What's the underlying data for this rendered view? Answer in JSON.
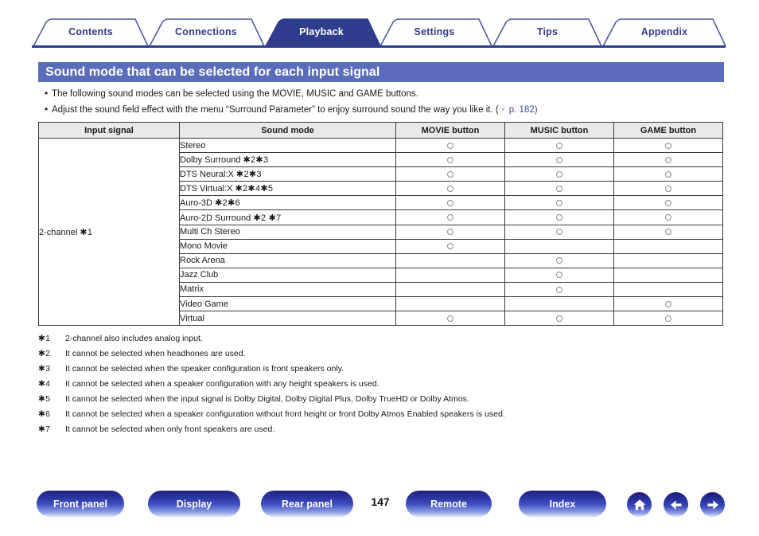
{
  "tabs": [
    {
      "label": "Contents",
      "active": false
    },
    {
      "label": "Connections",
      "active": false
    },
    {
      "label": "Playback",
      "active": true
    },
    {
      "label": "Settings",
      "active": false
    },
    {
      "label": "Tips",
      "active": false
    },
    {
      "label": "Appendix",
      "active": false
    }
  ],
  "section": {
    "title": "Sound mode that can be selected for each input signal"
  },
  "intro": [
    "The following sound modes can be selected using the MOVIE, MUSIC and GAME buttons.",
    "Adjust the sound field effect with the menu “Surround Parameter” to enjoy surround sound the way you like it.  (☞ p. 182)"
  ],
  "intro_parts": [
    {
      "text": "The following sound modes can be selected using the MOVIE, MUSIC and GAME buttons.",
      "ref": ""
    },
    {
      "text": "Adjust the sound field effect with the menu “Surround Parameter” to enjoy surround sound the way you like it.  (",
      "ref_icon": "☞",
      "ref": " p. 182)"
    }
  ],
  "table": {
    "headers": [
      "Input signal",
      "Sound mode",
      "MOVIE button",
      "MUSIC button",
      "GAME button"
    ],
    "input_signal": "2-channel ✱1",
    "input_signal_label": "2-channel",
    "input_signal_note": "✱1",
    "rows": [
      {
        "mode": "Stereo",
        "notes": "",
        "movie": true,
        "music": true,
        "game": true
      },
      {
        "mode": "Dolby Surround",
        "notes": "✱2✱3",
        "movie": true,
        "music": true,
        "game": true
      },
      {
        "mode": "DTS Neural:X",
        "notes": "✱2✱3",
        "movie": true,
        "music": true,
        "game": true
      },
      {
        "mode": "DTS Virtual:X",
        "notes": "✱2✱4✱5",
        "movie": true,
        "music": true,
        "game": true
      },
      {
        "mode": "Auro-3D",
        "notes": "✱2✱6",
        "movie": true,
        "music": true,
        "game": true
      },
      {
        "mode": "Auro-2D Surround",
        "notes": "✱2 ✱7",
        "movie": true,
        "music": true,
        "game": true
      },
      {
        "mode": "Multi Ch Stereo",
        "notes": "",
        "movie": true,
        "music": true,
        "game": true
      },
      {
        "mode": "Mono Movie",
        "notes": "",
        "movie": true,
        "music": false,
        "game": false
      },
      {
        "mode": "Rock Arena",
        "notes": "",
        "movie": false,
        "music": true,
        "game": false
      },
      {
        "mode": "Jazz Club",
        "notes": "",
        "movie": false,
        "music": true,
        "game": false
      },
      {
        "mode": "Matrix",
        "notes": "",
        "movie": false,
        "music": true,
        "game": false
      },
      {
        "mode": "Video Game",
        "notes": "",
        "movie": false,
        "music": false,
        "game": true
      },
      {
        "mode": "Virtual",
        "notes": "",
        "movie": true,
        "music": true,
        "game": true
      }
    ]
  },
  "footnotes": [
    {
      "key": "✱1",
      "text": "2-channel also includes analog input."
    },
    {
      "key": "✱2",
      "text": "It cannot be selected when headhones are used."
    },
    {
      "key": "✱3",
      "text": "It cannot be selected when the speaker configuration is front speakers only."
    },
    {
      "key": "✱4",
      "text": "It cannot be selected when a speaker configuration with any height speakers is used."
    },
    {
      "key": "✱5",
      "text": "It cannot be selected when the input signal is Dolby Digital, Dolby Digital Plus, Dolby TrueHD or Dolby Atmos."
    },
    {
      "key": "✱6",
      "text": "It cannot be selected when a speaker configuration without front height or front Dolby Atmos Enabled speakers is used."
    },
    {
      "key": "✱7",
      "text": "It cannot be selected when only front speakers are used."
    }
  ],
  "bottom_nav": {
    "page_number": "147",
    "buttons": [
      {
        "label": "Front panel"
      },
      {
        "label": "Display"
      },
      {
        "label": "Rear panel"
      },
      {
        "label": "Remote"
      },
      {
        "label": "Index"
      }
    ],
    "icons": [
      {
        "name": "home-icon"
      },
      {
        "name": "back-arrow-icon"
      },
      {
        "name": "forward-arrow-icon"
      }
    ]
  },
  "colors": {
    "tab_active_bg": "#2f3d8c",
    "tab_text": "#2f3d8c",
    "title_bar": "#5b6dba",
    "rule": "#2f3d8c",
    "table_header_bg": "#e9e9e9",
    "table_border": "#3a3a3a",
    "circle_border": "#8a8a8a",
    "ref_blue": "#3a4ba0"
  }
}
